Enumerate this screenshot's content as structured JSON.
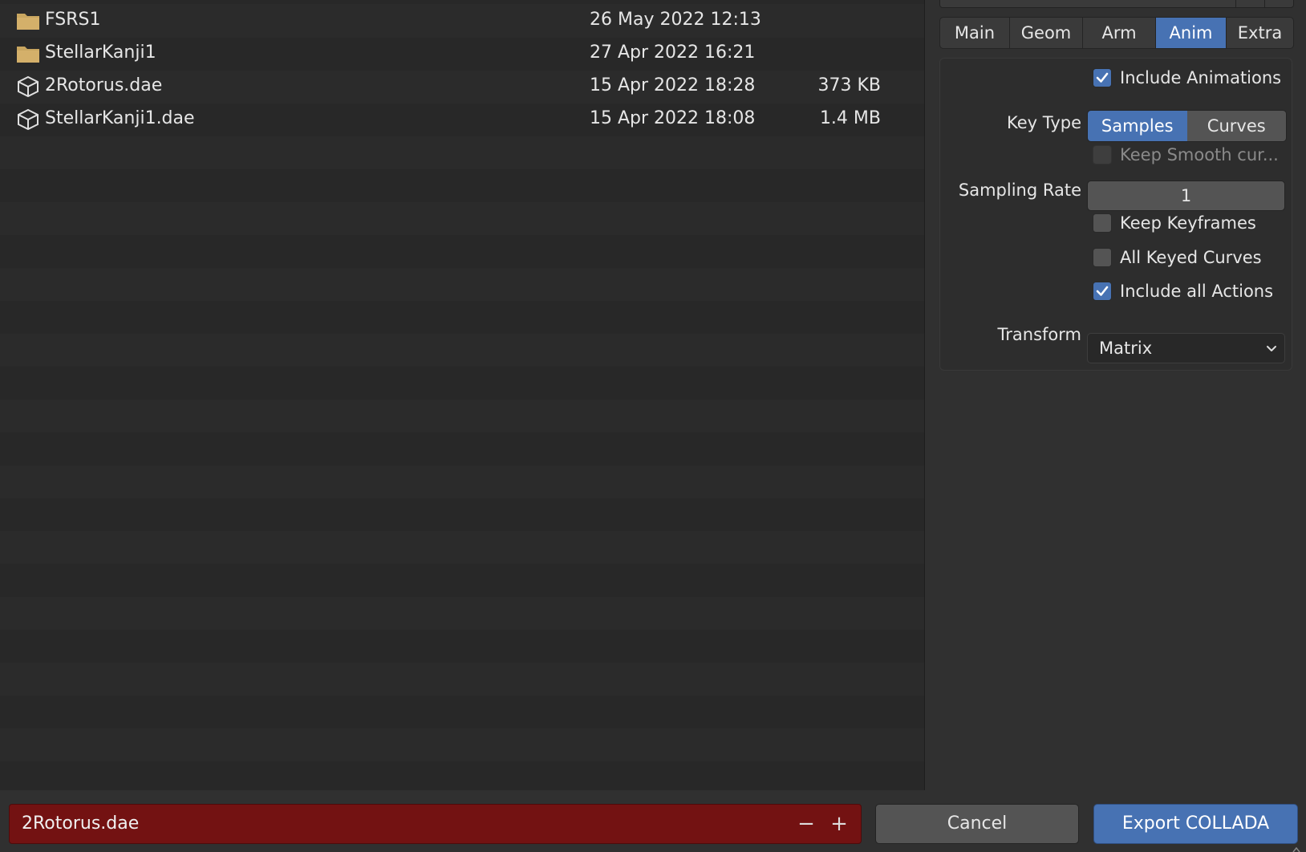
{
  "files": [
    {
      "name": "FSRS1",
      "date": "26 May 2022 12:13",
      "size": "",
      "icon": "folder-icon"
    },
    {
      "name": "StellarKanji1",
      "date": "27 Apr 2022 16:21",
      "size": "",
      "icon": "folder-icon"
    },
    {
      "name": "2Rotorus.dae",
      "date": "15 Apr 2022 18:28",
      "size": "373 KB",
      "icon": "mesh-cube-icon"
    },
    {
      "name": "StellarKanji1.dae",
      "date": "15 Apr 2022 18:08",
      "size": "1.4 MB",
      "icon": "mesh-cube-icon"
    }
  ],
  "tabs": [
    "Main",
    "Geom",
    "Arm",
    "Anim",
    "Extra"
  ],
  "active_tab": "Anim",
  "options": {
    "include_animations": {
      "label": "Include Animations",
      "checked": true
    },
    "key_type": {
      "label": "Key Type",
      "options": [
        "Samples",
        "Curves"
      ],
      "selected": "Samples"
    },
    "keep_smooth": {
      "label": "Keep Smooth cur...",
      "checked": false,
      "disabled": true
    },
    "sampling_rate": {
      "label": "Sampling Rate",
      "value": "1"
    },
    "keep_keyframes": {
      "label": "Keep Keyframes",
      "checked": false
    },
    "all_keyed_curves": {
      "label": "All Keyed Curves",
      "checked": false
    },
    "include_all_actions": {
      "label": "Include all Actions",
      "checked": true
    },
    "transform": {
      "label": "Transform",
      "value": "Matrix"
    }
  },
  "bottom": {
    "filename": "2Rotorus.dae",
    "decrement": "−",
    "increment": "+",
    "cancel_label": "Cancel",
    "export_label": "Export COLLADA"
  },
  "colors": {
    "accent": "#4772b3",
    "filename_error_bg": "#731212",
    "folder": "#c9a660"
  }
}
